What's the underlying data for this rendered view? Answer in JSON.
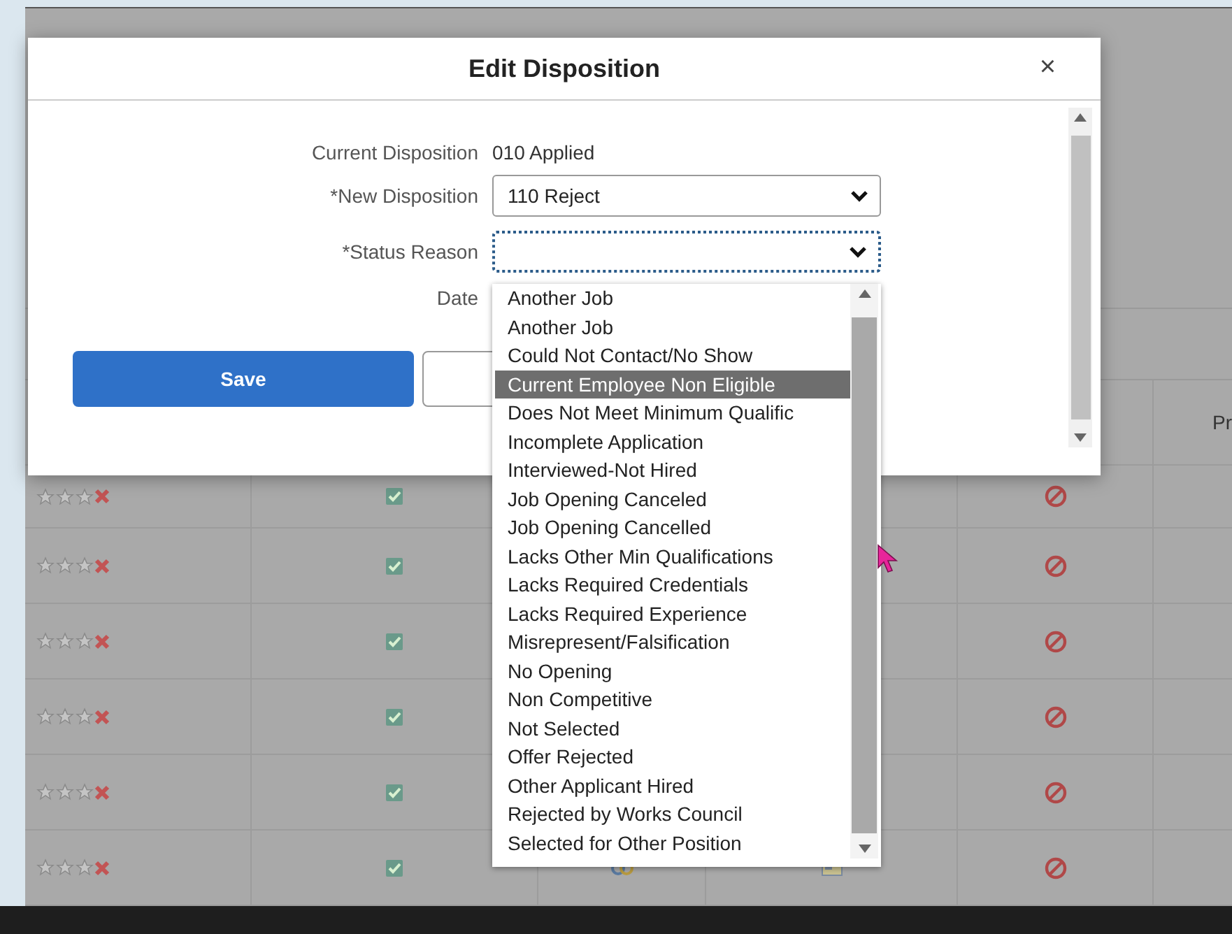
{
  "dialog": {
    "title": "Edit Disposition",
    "close": "×",
    "fields": [
      {
        "label": "Current Disposition",
        "kind": "text",
        "value": "010 Applied"
      },
      {
        "label": "*New Disposition",
        "kind": "select",
        "value": "110 Reject",
        "focused": false
      },
      {
        "label": "*Status Reason",
        "kind": "select",
        "focused": true
      },
      {
        "label": "Date",
        "kind": "text"
      }
    ],
    "buttons": [
      {
        "label": "Save",
        "kind": "primary"
      },
      {
        "kind": "secondary"
      }
    ]
  },
  "dropdown": {
    "options": [
      {
        "label": "Another Job",
        "selected": false
      },
      {
        "label": "Another Job",
        "selected": false
      },
      {
        "label": "Could Not Contact/No Show",
        "selected": false
      },
      {
        "label": "Current Employee Non Eligible",
        "selected": true
      },
      {
        "label": "Does Not Meet Minimum Qualific",
        "selected": false
      },
      {
        "label": "Incomplete Application",
        "selected": false
      },
      {
        "label": "Interviewed-Not Hired",
        "selected": false
      },
      {
        "label": "Job Opening Canceled",
        "selected": false
      },
      {
        "label": "Job Opening Cancelled",
        "selected": false
      },
      {
        "label": "Lacks Other Min Qualifications",
        "selected": false
      },
      {
        "label": "Lacks Required Credentials",
        "selected": false
      },
      {
        "label": "Lacks Required Experience",
        "selected": false
      },
      {
        "label": "Misrepresent/Falsification",
        "selected": false
      },
      {
        "label": "No Opening",
        "selected": false
      },
      {
        "label": "Non Competitive",
        "selected": false
      },
      {
        "label": "Not Selected",
        "selected": false
      },
      {
        "label": "Offer Rejected",
        "selected": false
      },
      {
        "label": "Other Applicant Hired",
        "selected": false
      },
      {
        "label": "Rejected by Works Council",
        "selected": false
      },
      {
        "label": "Selected for Other Position",
        "selected": false
      }
    ]
  },
  "table": {
    "column_6_header": "Pr",
    "rows": [
      {
        "stars": 0
      },
      {
        "stars": 0
      },
      {
        "stars": 0
      },
      {
        "stars": 0
      },
      {
        "stars": 0
      },
      {
        "stars": 0
      }
    ]
  }
}
